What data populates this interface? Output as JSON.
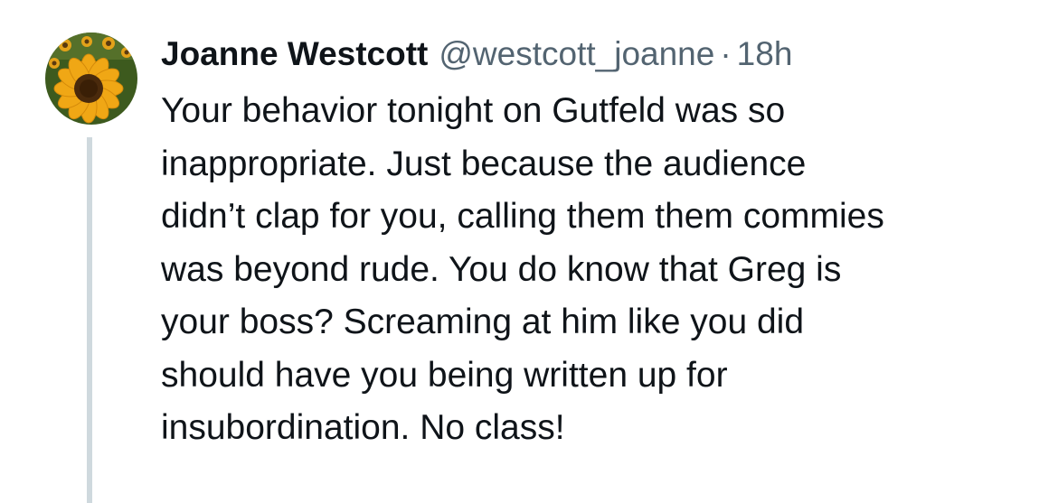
{
  "tweet": {
    "author": {
      "display_name": "Joanne Westcott",
      "handle": "@westcott_joanne",
      "avatar_icon": "sunflower-avatar"
    },
    "separator": "·",
    "timestamp": "18h",
    "text": "Your behavior tonight on Gutfeld was so\ninappropriate. Just because the audience\ndidn’t clap for you, calling them them commies\nwas beyond rude. You do know that Greg is\nyour boss? Screaming at him like you did\nshould have you being written up for\ninsubordination. No class!"
  },
  "colors": {
    "text_primary": "#0f1419",
    "text_secondary": "#536471",
    "thread_line": "#cfd9de",
    "background": "#ffffff"
  }
}
